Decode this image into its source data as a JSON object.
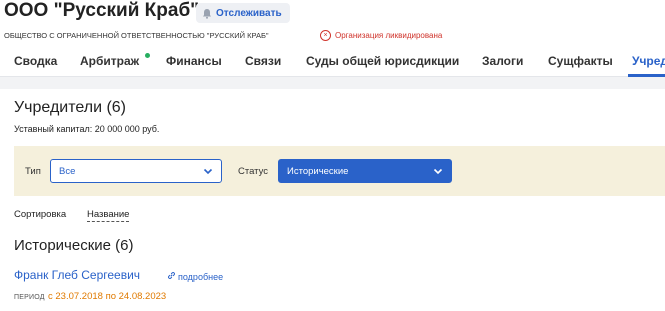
{
  "company": {
    "title": "ООО \"Русский Краб\"",
    "follow_label": "Отслеживать",
    "full_name": "ОБЩЕСТВО С ОГРАНИЧЕННОЙ ОТВЕТСТВЕННОСТЬЮ \"РУССКИЙ КРАБ\"",
    "status_text": "Организация ликвидирована"
  },
  "tabs": [
    {
      "label": "Сводка"
    },
    {
      "label": "Арбитраж",
      "has_dot": true
    },
    {
      "label": "Финансы"
    },
    {
      "label": "Связи"
    },
    {
      "label": "Суды общей юрисдикции"
    },
    {
      "label": "Залоги"
    },
    {
      "label": "Сущфакты"
    },
    {
      "label": "Учред",
      "active": true
    }
  ],
  "founders": {
    "title": "Учредители (6)",
    "capital": "Уставный капитал: 20 000 000 руб."
  },
  "filters": {
    "type_label": "Тип",
    "type_value": "Все",
    "status_label": "Статус",
    "status_value": "Исторические"
  },
  "sort": {
    "label": "Сортировка",
    "value": "Название"
  },
  "historical": {
    "title": "Исторические (6)",
    "items": [
      {
        "name": "Франк Глеб Сергеевич",
        "more_label": "подробнее",
        "period_label": "ПЕРИОД",
        "period_value": "с 23.07.2018 по 24.08.2023"
      }
    ]
  },
  "colors": {
    "accent": "#2a62c9",
    "danger": "#d0342c",
    "period": "#e07a00",
    "filter_bg": "#f5f0dc",
    "notify_dot": "#27ae60"
  }
}
